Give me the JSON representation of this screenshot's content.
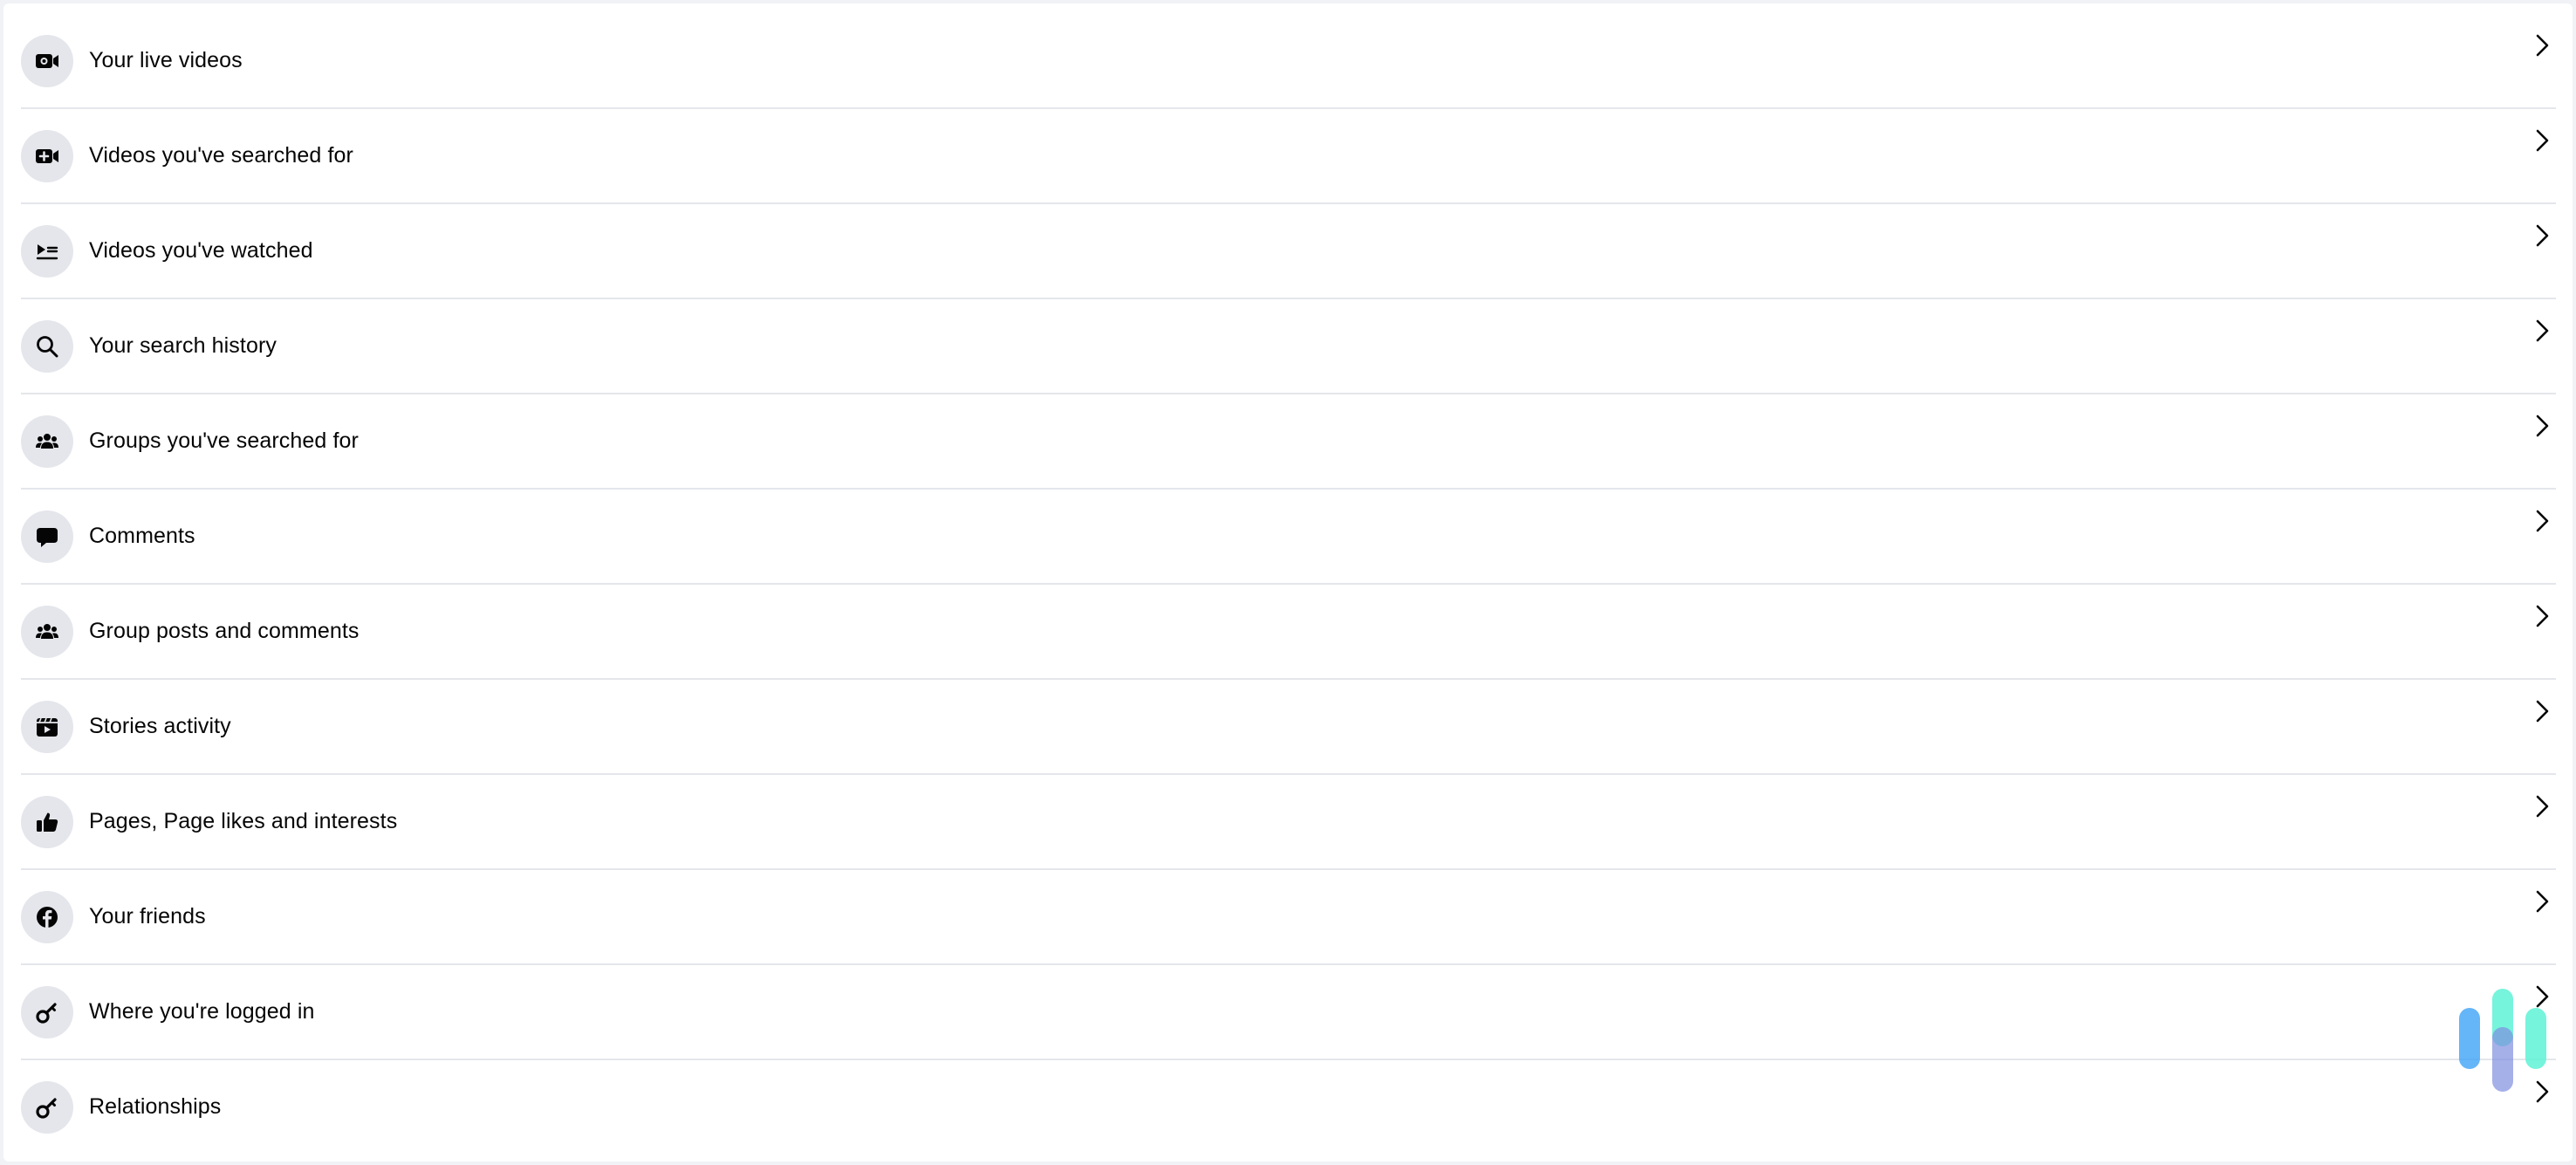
{
  "rows": [
    {
      "label": "Your live videos",
      "icon": "live-video-icon"
    },
    {
      "label": "Videos you've searched for",
      "icon": "video-plus-icon"
    },
    {
      "label": "Videos you've watched",
      "icon": "video-list-icon"
    },
    {
      "label": "Your search history",
      "icon": "search-icon"
    },
    {
      "label": "Groups you've searched for",
      "icon": "groups-icon"
    },
    {
      "label": "Comments",
      "icon": "comment-icon"
    },
    {
      "label": "Group posts and comments",
      "icon": "groups-icon"
    },
    {
      "label": "Stories activity",
      "icon": "stories-icon"
    },
    {
      "label": "Pages, Page likes and interests",
      "icon": "thumbs-up-icon"
    },
    {
      "label": "Your friends",
      "icon": "facebook-icon"
    },
    {
      "label": "Where you're logged in",
      "icon": "key-icon"
    },
    {
      "label": "Relationships",
      "icon": "key-icon"
    }
  ],
  "colors": {
    "page_background": "#f0f2f5",
    "panel_background": "#ffffff",
    "icon_circle": "#e4e6eb",
    "text": "#050505",
    "divider": "#e4e6eb"
  }
}
